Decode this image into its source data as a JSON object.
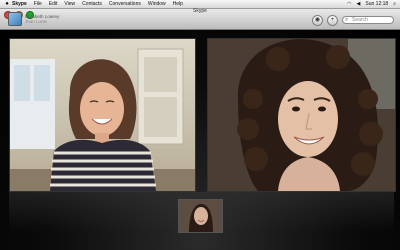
{
  "menubar": {
    "apple": "",
    "menus": [
      "Skype",
      "File",
      "Edit",
      "View",
      "Contacts",
      "Conversations",
      "Window",
      "Help"
    ],
    "clock": "Sun 12:18"
  },
  "window": {
    "title": "Skype",
    "contact_name": "Elizabeth Lowrey",
    "contact_sub": "Jhan Lunie"
  },
  "search": {
    "placeholder": "Search"
  },
  "icons": {
    "camera": "camera-icon",
    "add": "add-icon"
  }
}
